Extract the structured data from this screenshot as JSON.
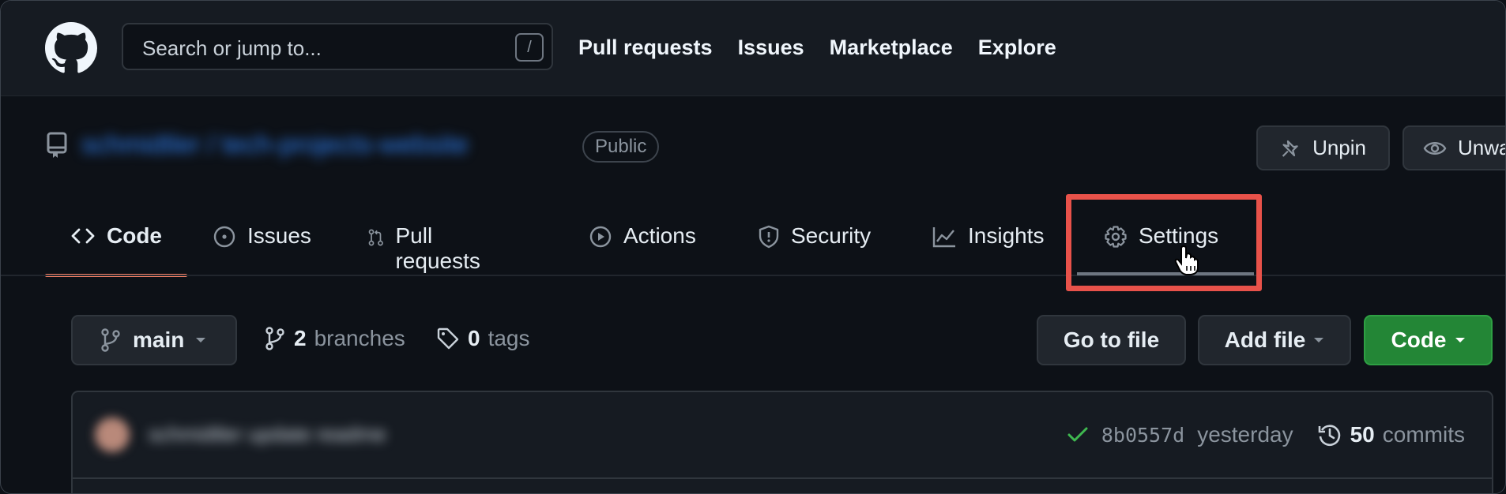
{
  "header": {
    "search_placeholder": "Search or jump to...",
    "search_shortcut": "/",
    "nav": [
      "Pull requests",
      "Issues",
      "Marketplace",
      "Explore"
    ]
  },
  "repo": {
    "name": "schmidtler / tech-projects-website",
    "visibility": "Public",
    "unpin_label": "Unpin",
    "unwatch_label": "Unwa"
  },
  "tabs": [
    {
      "label": "Code",
      "icon": "code-icon",
      "active": true
    },
    {
      "label": "Issues",
      "icon": "issue-icon"
    },
    {
      "label": "Pull requests",
      "icon": "pull-request-icon"
    },
    {
      "label": "Actions",
      "icon": "play-icon"
    },
    {
      "label": "Security",
      "icon": "shield-icon"
    },
    {
      "label": "Insights",
      "icon": "graph-icon"
    },
    {
      "label": "Settings",
      "icon": "gear-icon",
      "hovered": true
    }
  ],
  "toolbar": {
    "branch": "main",
    "branches_count": "2",
    "branches_label": "branches",
    "tags_count": "0",
    "tags_label": "tags",
    "go_to_file": "Go to file",
    "add_file": "Add file",
    "code": "Code"
  },
  "commit": {
    "author": "schmidtler update readme",
    "sha": "8b0557d",
    "time": "yesterday",
    "commits_count": "50",
    "commits_label": "commits"
  },
  "colors": {
    "accent_underline": "#f78166",
    "highlight_box": "#e8524a",
    "code_button": "#238636",
    "check": "#3fb950"
  }
}
